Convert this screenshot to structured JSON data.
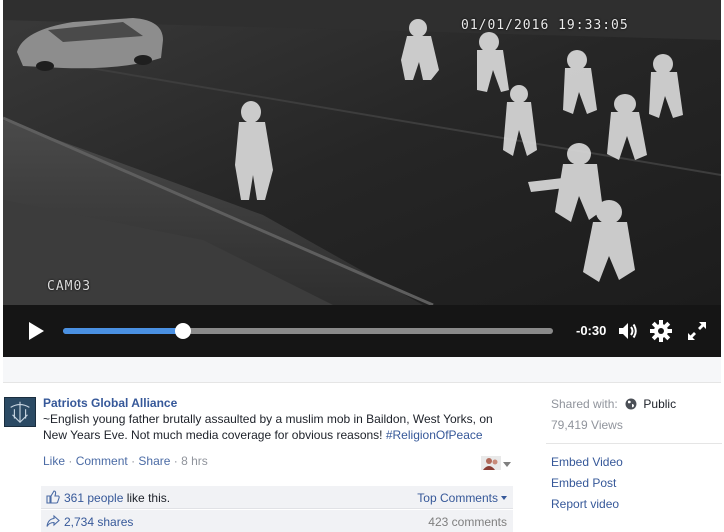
{
  "video": {
    "timestamp": "01/01/2016 19:33:05",
    "camera_label": "CAM03",
    "remaining_time": "-0:30",
    "progress": 0.245
  },
  "post": {
    "page_name": "Patriots Global Alliance",
    "text": "~English young father brutally assaulted by a muslim mob in Baildon, West Yorks, on New Years Eve. Not much media coverage for obvious reasons! ",
    "hashtag": "#ReligionOfPeace",
    "actions": {
      "like": "Like",
      "comment": "Comment",
      "share": "Share",
      "time": "8 hrs"
    },
    "likes": {
      "count": "361 people",
      "suffix": " like this."
    },
    "top_comments": "Top Comments",
    "shares": "2,734 shares",
    "comments": "423 comments"
  },
  "sidebar": {
    "shared_with_label": "Shared with:",
    "audience": "Public",
    "views": "79,419 Views",
    "links": [
      "Embed Video",
      "Embed Post",
      "Report video"
    ]
  },
  "colors": {
    "link": "#365899",
    "progress_fill": "#4a90e2",
    "player_bg": "#151515"
  },
  "icons": [
    "play-icon",
    "volume-icon",
    "settings-gear-icon",
    "fullscreen-icon",
    "thumbs-up-icon",
    "share-arrow-icon",
    "globe-icon",
    "privacy-friends-icon"
  ]
}
